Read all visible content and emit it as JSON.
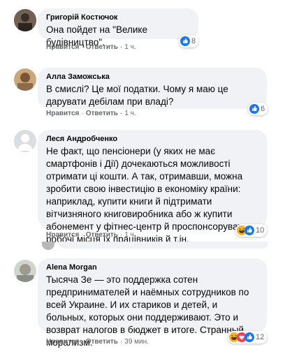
{
  "comments": [
    {
      "author": "Григорій Костючок",
      "text": "Она пойдет на \"Велике будівництво\".",
      "like": "Нравится",
      "reply": "Ответить",
      "time": "1 ч.",
      "reactions": "8"
    },
    {
      "author": "Алла Заможська",
      "text": "В смислі? Це мої податки. Чому я маю це дарувати дебілам при владі?",
      "like": "Нравится",
      "reply": "Ответить",
      "time": "1 ч.",
      "reactions": "6"
    },
    {
      "author": "Леся Андробченко",
      "text": "Не факт, що пенсіонери (у яких не має смартфонів і Дії) дочекаються можливості отримати ці кошти. А так, отримавши, можна зробити свою інвестицію в економіку країни: наприклад, купити книги й підтримати вітчизняного книговиробника або ж купити абонемент у фітнес-центр й проспонсорувати робочі місця їх працівників й т.ін.",
      "like": "Нравится",
      "reply": "Ответить",
      "time": "1 ч.",
      "reactions": "10"
    },
    {
      "author": "Alena Morgan",
      "text": "Тысяча Зе — это поддержка сотен предпринимателей и наёмных сотрудников по всей Украине. И их стариков и детей, и больных, которых они поддерживают. Это и возврат налогов в бюджет в итоге. Странный морализм.",
      "like": "Нравится",
      "reply": "Ответить",
      "time": "39 мин.",
      "reactions": "12"
    }
  ],
  "colors": {
    "bubble": "#f0f2f5",
    "meta": "#65676b",
    "like_blue": "#1877f2",
    "love_red": "#f33e58",
    "haha_yellow": "#f7b125"
  },
  "icons": [
    "like-icon",
    "love-icon",
    "haha-icon"
  ]
}
